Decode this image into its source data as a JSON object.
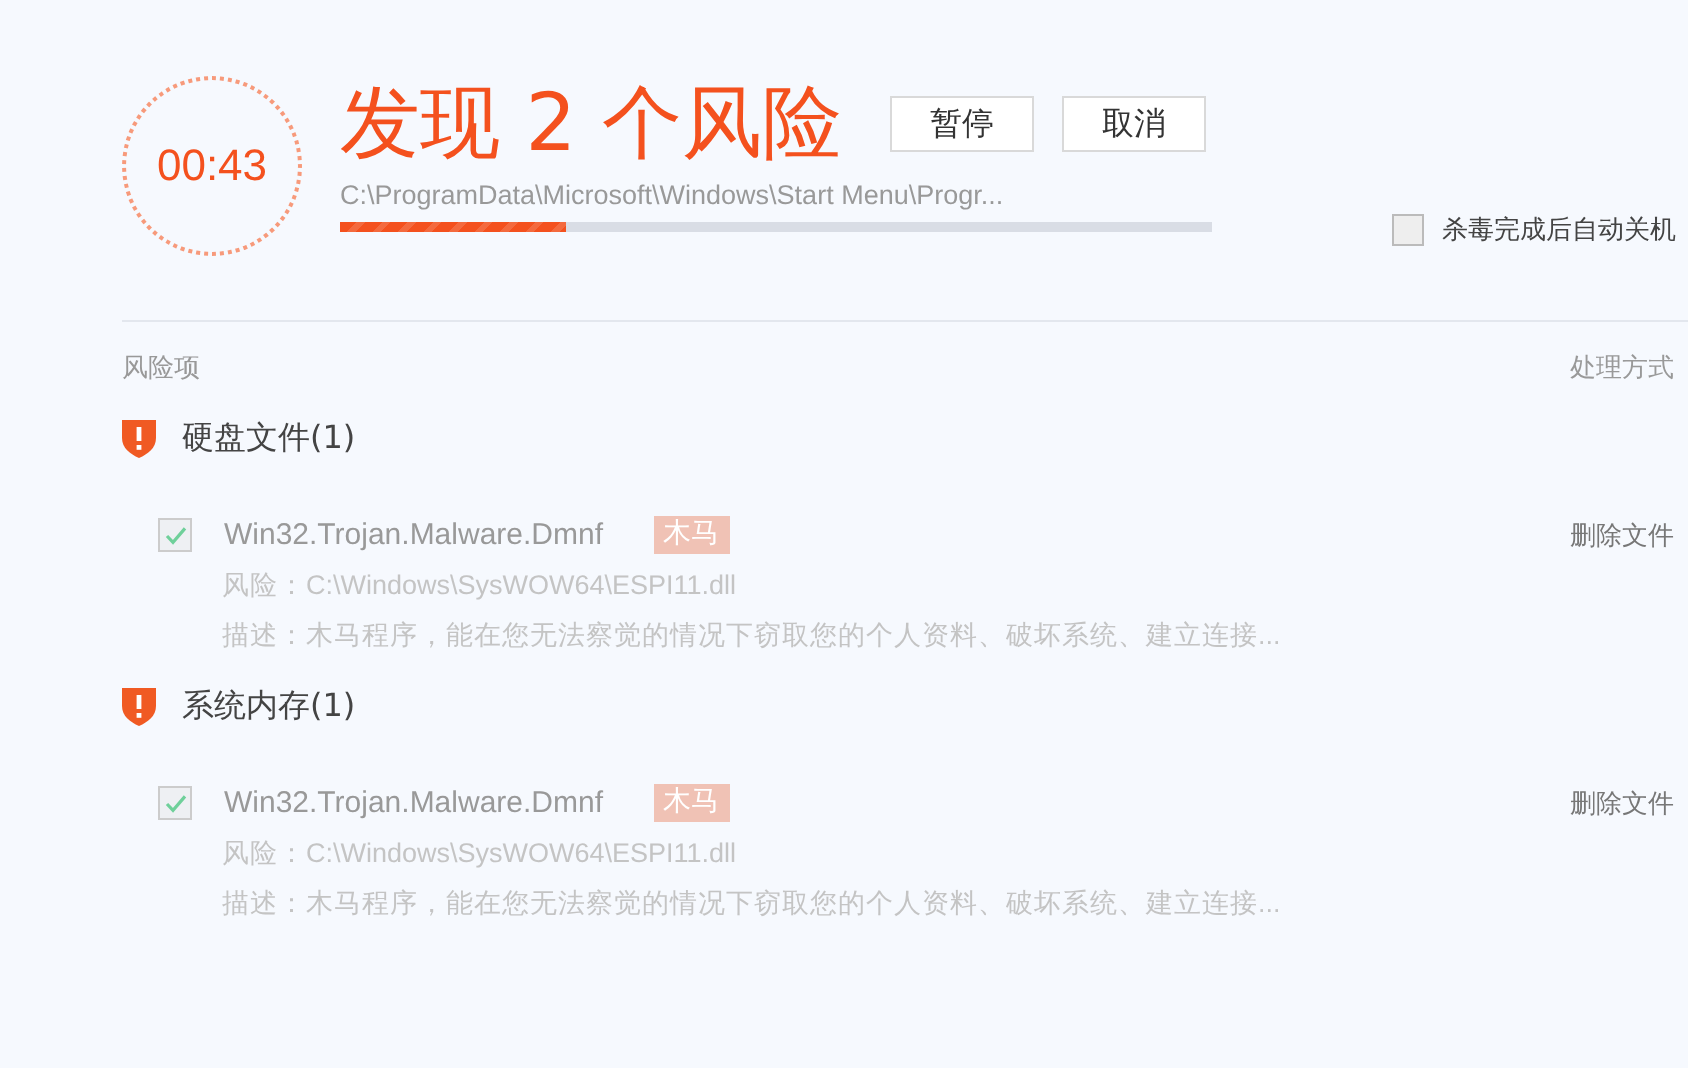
{
  "timer": "00:43",
  "title": "发现 2 个风险",
  "buttons": [
    {
      "label": "暂停"
    },
    {
      "label": "取消"
    }
  ],
  "current_path": "C:\\ProgramData\\Microsoft\\Windows\\Start Menu\\Progr...",
  "progress": {
    "level": 0.26
  },
  "auto_shutdown": {
    "label": "杀毒完成后自动关机",
    "checked": false
  },
  "columns": [
    "风险项",
    "处理方式"
  ],
  "groups": [
    {
      "title": "硬盘文件(1)",
      "items": [
        {
          "checked": true,
          "name": "Win32.Trojan.Malware.Dmnf",
          "tag": "木马",
          "risk": "风险：C:\\Windows\\SysWOW64\\ESPI11.dll",
          "description": "描述：木马程序，能在您无法察觉的情况下窃取您的个人资料、破坏系统、建立连接...",
          "action": "删除文件"
        }
      ]
    },
    {
      "title": "系统内存(1)",
      "items": [
        {
          "checked": true,
          "name": "Win32.Trojan.Malware.Dmnf",
          "tag": "木马",
          "risk": "风险：C:\\Windows\\SysWOW64\\ESPI11.dll",
          "description": "描述：木马程序，能在您无法察觉的情况下窃取您的个人资料、破坏系统、建立连接...",
          "action": "删除文件"
        }
      ]
    }
  ]
}
